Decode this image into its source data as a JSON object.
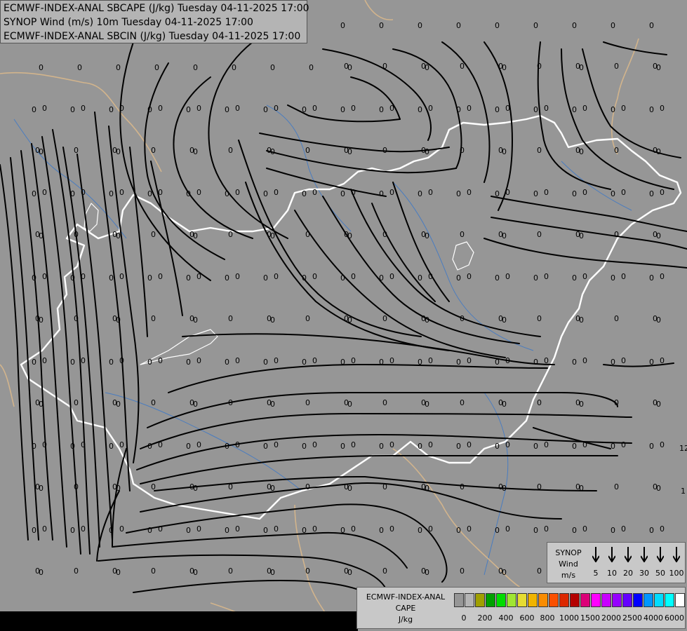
{
  "title_lines": [
    "ECMWF-INDEX-ANAL SBCAPE (J/kg) Tuesday 04-11-2025 17:00",
    "SYNOP Wind (m/s) 10m Tuesday 04-11-2025 17:00",
    "ECMWF-INDEX-ANAL SBCIN (J/kg) Tuesday 04-11-2025 17:00"
  ],
  "colors": {
    "background": "#969696",
    "border_white": "#ffffff",
    "border_tan": "#d2b48c",
    "river": "#3c78c8",
    "streamline": "#000000"
  },
  "value_label": "0",
  "edge_values": [
    "12",
    "1"
  ],
  "wind_legend": {
    "title": [
      "SYNOP",
      "Wind",
      "m/s"
    ],
    "labels": [
      "5",
      "10",
      "20",
      "30",
      "50",
      "100"
    ]
  },
  "cape_legend": {
    "title": [
      "ECMWF-INDEX-ANAL",
      "CAPE",
      "J/kg"
    ],
    "labels": [
      "0",
      "200",
      "400",
      "600",
      "800",
      "1000",
      "1500",
      "2000",
      "2500",
      "4000",
      "6000"
    ],
    "swatches": [
      "#969696",
      "#b4b4b4",
      "#a0a000",
      "#00a000",
      "#00dc00",
      "#a0e632",
      "#e6dc32",
      "#f0b400",
      "#fa8c00",
      "#fa5000",
      "#dc2800",
      "#b40000",
      "#dc0078",
      "#ff00ff",
      "#c800ff",
      "#9600ff",
      "#6400ff",
      "#0000ff",
      "#0096ff",
      "#00dcff",
      "#00ffff",
      "#ffffff"
    ]
  }
}
